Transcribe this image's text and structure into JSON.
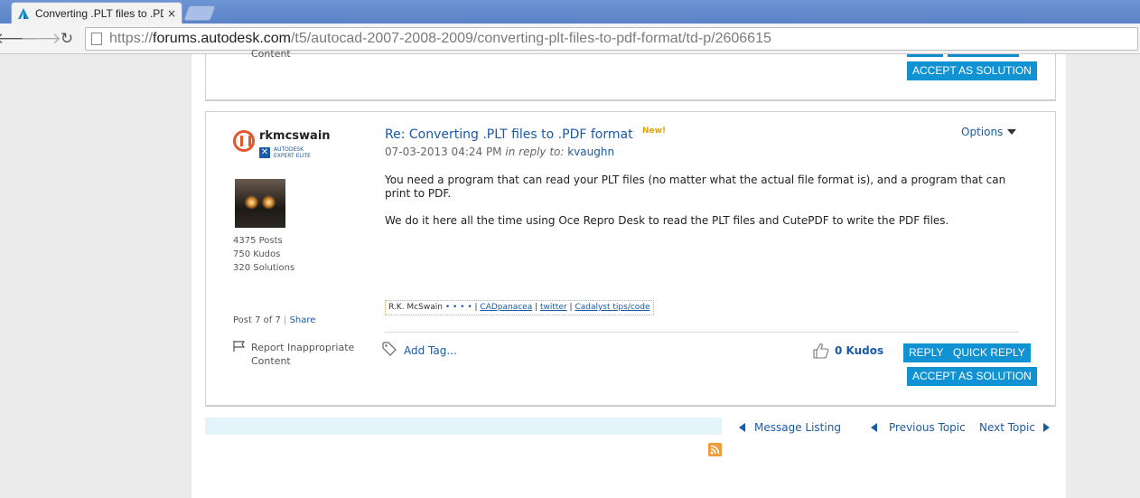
{
  "browser": {
    "tab_title": "Converting .PLT files to .PDF",
    "tab_close": "×",
    "url_prefix": "https://",
    "url_host": "forums.autodesk.com",
    "url_path": "/t5/autocad-2007-2008-2009/converting-plt-files-to-pdf-format/td-p/2606615",
    "back_glyph": "🡐",
    "forward_glyph": "🡒",
    "reload_glyph": "↻"
  },
  "prev_post": {
    "content_label": "Content",
    "accept_label": "ACCEPT AS SOLUTION"
  },
  "post": {
    "author": {
      "username": "rkmcswain",
      "rank_line1": "AUTODESK",
      "rank_line2": "EXPERT ELITE",
      "posts": "4375 Posts",
      "kudos": "750 Kudos",
      "solutions": "320 Solutions"
    },
    "subject": "Re: Converting .PLT files to .PDF format",
    "new_badge": "New!",
    "date": "07-03-2013 04:24 PM",
    "in_reply_to_label": "in reply to:",
    "in_reply_to_user": "kvaughn",
    "options_label": "Options",
    "body": [
      "You need a program that can read your PLT files (no matter what the actual file format is), and a program that can print to PDF.",
      "We do it here all the time using Oce Repro Desk to read the PLT files and CutePDF to write the PDF files."
    ],
    "signature": {
      "name": "R.K. McSwain",
      "dots": "• • • •",
      "links": [
        "CADpanacea",
        "twitter",
        "Cadalyst tips/code"
      ]
    },
    "post_number": "Post 7 of 7",
    "share_label": "Share",
    "report_label": "Report Inappropriate Content",
    "add_tag_label": "Add Tag...",
    "kudos_label": "0 Kudos",
    "reply_label": "REPLY",
    "quick_reply_label": "QUICK REPLY",
    "accept_label": "ACCEPT AS SOLUTION"
  },
  "footer_nav": {
    "message_listing": "Message Listing",
    "previous_topic": "Previous Topic",
    "next_topic": "Next Topic"
  },
  "colors": {
    "accent_blue": "#1192d3",
    "link_blue": "#1a5aa6",
    "new_badge": "#e6a100",
    "rss_orange": "#f39b3a"
  }
}
